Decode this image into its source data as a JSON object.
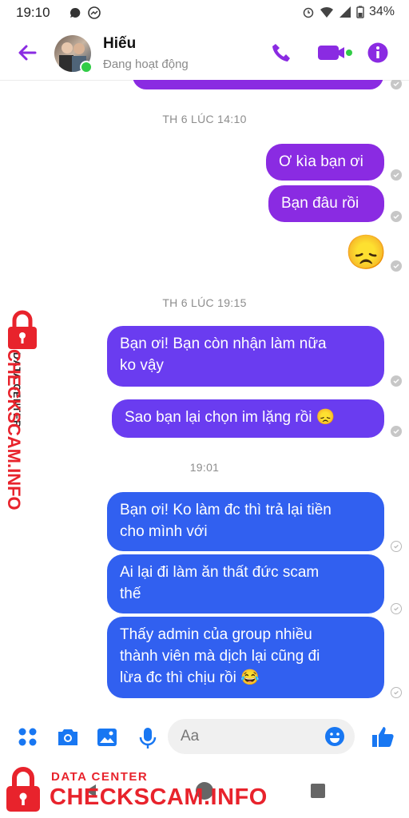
{
  "status_bar": {
    "time": "19:10",
    "battery": "34%"
  },
  "header": {
    "contact_name": "Hiếu",
    "presence": "Đang hoạt động",
    "accent_color": "#8a2be2"
  },
  "messages": {
    "timestamp_1": "TH 6 LÚC 14:10",
    "msg_1": "Ơ kìa bạn ơi",
    "msg_2": "Bạn đâu rồi",
    "emoji_1": "😞",
    "timestamp_2": "TH 6 LÚC 19:15",
    "msg_3_line1": "Bạn ơi! Bạn còn nhận làm nữa",
    "msg_3_line2": "ko vậy",
    "msg_4": "Sao bạn lại chọn im lặng rồi 😞",
    "timestamp_3": "19:01",
    "msg_5_line1": "Bạn ơi! Ko làm đc thì trả lại tiền",
    "msg_5_line2": "cho mình với",
    "msg_6_line1": "Ai lại đi làm ăn thất đức scam",
    "msg_6_line2": "thế",
    "msg_7_line1": "Thấy admin của group nhiều",
    "msg_7_line2": "thành viên mà dịch lại cũng đi",
    "msg_7_line3": "lừa đc thì chịu rồi 😂"
  },
  "composer": {
    "placeholder": "Aa"
  },
  "watermark": {
    "label": "DATA CENTER",
    "brand": "CHECKSCAM.INFO"
  },
  "icons": [
    "back-arrow-icon",
    "phone-icon",
    "video-icon",
    "info-icon",
    "menu-dots-icon",
    "camera-icon",
    "gallery-icon",
    "mic-icon",
    "emoji-icon",
    "like-icon",
    "lock-icon"
  ]
}
